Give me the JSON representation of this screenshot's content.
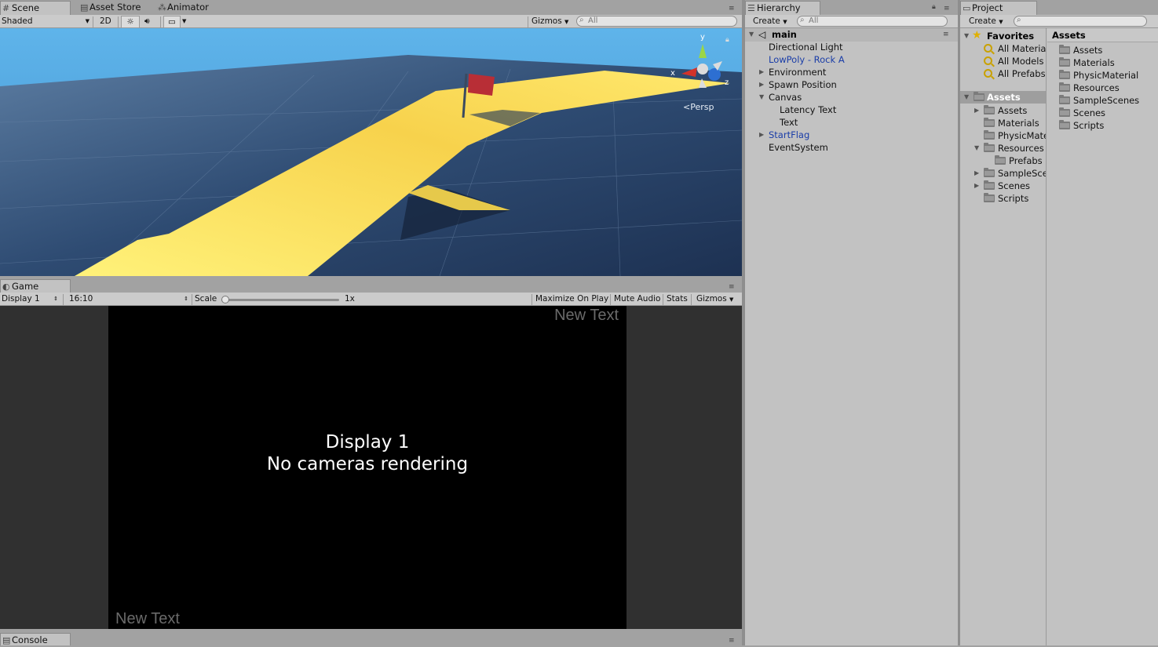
{
  "scene": {
    "tabs": [
      {
        "label": "Scene",
        "icon": "grid-icon"
      },
      {
        "label": "Asset Store",
        "icon": "store-icon"
      },
      {
        "label": "Animator",
        "icon": "animator-icon"
      }
    ],
    "shading_mode": "Shaded",
    "btn_2d": "2D",
    "gizmos_label": "Gizmos",
    "search_placeholder": "All",
    "gizmo": {
      "x": "x",
      "y": "y",
      "z": "z",
      "projection": "Persp"
    }
  },
  "game": {
    "tab_label": "Game",
    "display_select": "Display 1",
    "aspect_select": "16:10",
    "scale_label": "Scale",
    "scale_value": "1x",
    "scale_slider_fraction": 0.0,
    "maximize_on_play": "Maximize On Play",
    "mute_audio": "Mute Audio",
    "stats": "Stats",
    "gizmos_label": "Gizmos",
    "viewport_top_right_text": "New Text",
    "viewport_bottom_left_text": "New Text",
    "viewport_message_line1": "Display 1",
    "viewport_message_line2": "No cameras rendering"
  },
  "console": {
    "tab_label": "Console"
  },
  "hierarchy": {
    "tab_label": "Hierarchy",
    "create_label": "Create",
    "search_placeholder": "All",
    "scene_name": "main",
    "items": [
      {
        "label": "Directional Light",
        "depth": 1,
        "expander": "none",
        "color": "black"
      },
      {
        "label": "LowPoly - Rock A",
        "depth": 1,
        "expander": "none",
        "color": "blue"
      },
      {
        "label": "Environment",
        "depth": 1,
        "expander": "collapsed",
        "color": "black"
      },
      {
        "label": "Spawn Position",
        "depth": 1,
        "expander": "collapsed",
        "color": "black"
      },
      {
        "label": "Canvas",
        "depth": 1,
        "expander": "expanded",
        "color": "black"
      },
      {
        "label": "Latency Text",
        "depth": 2,
        "expander": "none",
        "color": "black"
      },
      {
        "label": "Text",
        "depth": 2,
        "expander": "none",
        "color": "black"
      },
      {
        "label": "StartFlag",
        "depth": 1,
        "expander": "collapsed",
        "color": "blue"
      },
      {
        "label": "EventSystem",
        "depth": 1,
        "expander": "none",
        "color": "black"
      }
    ]
  },
  "project": {
    "tab_label": "Project",
    "create_label": "Create",
    "favorites_label": "Favorites",
    "favorites": [
      "All Materia",
      "All Models",
      "All Prefabs"
    ],
    "assets_root": "Assets",
    "tree": [
      {
        "label": "Assets",
        "depth": 1,
        "expander": "collapsed"
      },
      {
        "label": "Materials",
        "depth": 1,
        "expander": "none"
      },
      {
        "label": "PhysicMate",
        "depth": 1,
        "expander": "none"
      },
      {
        "label": "Resources",
        "depth": 1,
        "expander": "expanded"
      },
      {
        "label": "Prefabs",
        "depth": 2,
        "expander": "none"
      },
      {
        "label": "SampleSce",
        "depth": 1,
        "expander": "collapsed"
      },
      {
        "label": "Scenes",
        "depth": 1,
        "expander": "collapsed"
      },
      {
        "label": "Scripts",
        "depth": 1,
        "expander": "none"
      }
    ],
    "content_header": "Assets",
    "content_items": [
      "Assets",
      "Materials",
      "PhysicMaterial",
      "Resources",
      "SampleScenes",
      "Scenes",
      "Scripts"
    ]
  },
  "colors": {
    "sky": "#4aa3e0",
    "ground": "#34517a",
    "path": "#f8e86a",
    "flag": "#c83a3a",
    "game_bg": "#000000",
    "editor_gray": "#a2a2a2"
  }
}
